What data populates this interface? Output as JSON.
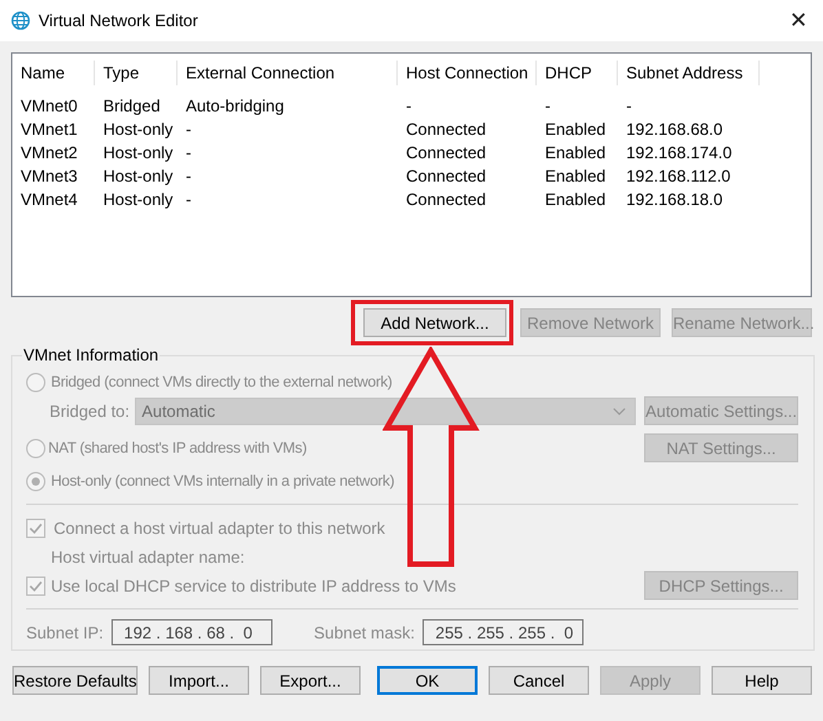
{
  "window": {
    "title": "Virtual Network Editor",
    "close_glyph": "✕"
  },
  "table": {
    "columns": [
      "Name",
      "Type",
      "External Connection",
      "Host Connection",
      "DHCP",
      "Subnet Address"
    ],
    "rows": [
      [
        "VMnet0",
        "Bridged",
        "Auto-bridging",
        "-",
        "-",
        "-"
      ],
      [
        "VMnet1",
        "Host-only",
        "-",
        "Connected",
        "Enabled",
        "192.168.68.0"
      ],
      [
        "VMnet2",
        "Host-only",
        "-",
        "Connected",
        "Enabled",
        "192.168.174.0"
      ],
      [
        "VMnet3",
        "Host-only",
        "-",
        "Connected",
        "Enabled",
        "192.168.112.0"
      ],
      [
        "VMnet4",
        "Host-only",
        "-",
        "Connected",
        "Enabled",
        "192.168.18.0"
      ]
    ]
  },
  "network_buttons": [
    {
      "label": "Add Network...",
      "disabled": false
    },
    {
      "label": "Remove Network",
      "disabled": true
    },
    {
      "label": "Rename Network...",
      "disabled": true
    }
  ],
  "vmnet_information": {
    "title": "VMnet Information",
    "connection_types": [
      {
        "label": "Bridged (connect VMs directly to the external network)",
        "selected": false,
        "disabled": true
      },
      {
        "label": "NAT (shared host's IP address with VMs)",
        "selected": false,
        "disabled": true
      },
      {
        "label": "Host-only (connect VMs internally in a private network)",
        "selected": true,
        "disabled": true
      }
    ],
    "bridged_to": {
      "label": "Bridged to:",
      "value": "Automatic",
      "disabled": true
    },
    "automatic_settings": {
      "label": "Automatic Settings...",
      "disabled": true
    },
    "nat_settings": {
      "label": "NAT Settings...",
      "disabled": true
    },
    "connect_adapter": {
      "label": "Connect a host virtual adapter to this network",
      "checked": true,
      "disabled": true
    },
    "adapter_name_label": "Host virtual adapter name:",
    "use_dhcp": {
      "label": "Use local DHCP service to distribute IP address to VMs",
      "checked": true,
      "disabled": true
    },
    "dhcp_settings": {
      "label": "DHCP Settings...",
      "disabled": true
    },
    "subnet_ip": {
      "label": "Subnet IP:",
      "value": "192 . 168 . 68 .  0"
    },
    "subnet_mask": {
      "label": "Subnet mask:",
      "value": "255 . 255 . 255 .  0"
    }
  },
  "footer_buttons": [
    {
      "label": "Restore Defaults",
      "disabled": false,
      "default": false
    },
    {
      "label": "Import...",
      "disabled": false,
      "default": false
    },
    {
      "label": "Export...",
      "disabled": false,
      "default": false
    },
    {
      "label": "OK",
      "disabled": false,
      "default": true
    },
    {
      "label": "Cancel",
      "disabled": false,
      "default": false
    },
    {
      "label": "Apply",
      "disabled": true,
      "default": false
    },
    {
      "label": "Help",
      "disabled": false,
      "default": false
    }
  ]
}
